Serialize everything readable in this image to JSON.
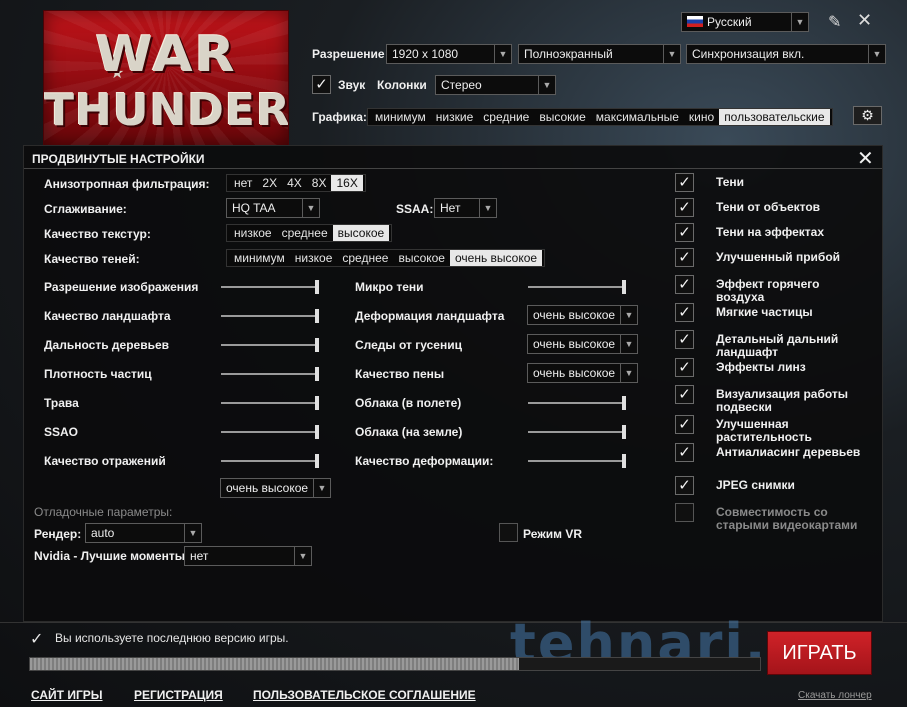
{
  "top": {
    "language": "Русский",
    "resolution_label": "Разрешение",
    "resolution_value": "1920 x 1080",
    "window_mode": "Полноэкранный",
    "vsync": "Синхронизация вкл.",
    "sound_label": "Звук",
    "speakers_label": "Колонки",
    "speakers_value": "Стерео",
    "graphics_label": "Графика:",
    "graphics_presets": [
      "минимум",
      "низкие",
      "средние",
      "высокие",
      "максимальные",
      "кино",
      "пользовательские"
    ],
    "graphics_selected_index": 6,
    "logo_word1": "WAR",
    "logo_word2": "THUNDER"
  },
  "panel": {
    "title": "ПРОДВИНУТЫЕ НАСТРОЙКИ",
    "anisotropy_label": "Анизотропная фильтрация:",
    "anisotropy_options": [
      "нет",
      "2X",
      "4X",
      "8X",
      "16X"
    ],
    "anisotropy_selected": 4,
    "aa_label": "Сглаживание:",
    "aa_value": "HQ TAA",
    "ssaa_label": "SSAA:",
    "ssaa_value": "Нет",
    "texture_label": "Качество текстур:",
    "texture_options": [
      "низкое",
      "среднее",
      "высокое"
    ],
    "texture_selected": 2,
    "shadow_label": "Качество теней:",
    "shadow_options": [
      "минимум",
      "низкое",
      "среднее",
      "высокое",
      "очень высокое"
    ],
    "shadow_selected": 4,
    "left_sliders": [
      {
        "label": "Разрешение изображения",
        "value": 1.0
      },
      {
        "label": "Качество ландшафта",
        "value": 1.0
      },
      {
        "label": "Дальность деревьев",
        "value": 1.0
      },
      {
        "label": "Плотность частиц",
        "value": 1.0
      },
      {
        "label": "Трава",
        "value": 1.0
      },
      {
        "label": "SSAO",
        "value": 1.0
      },
      {
        "label": "Качество отражений",
        "value": 1.0
      }
    ],
    "reflection_dropdown": "очень высокое",
    "middle_rows": [
      {
        "label": "Микро тени",
        "type": "slider",
        "value": 1.0
      },
      {
        "label": "Деформация ландшафта",
        "type": "dropdown",
        "value": "очень высокое"
      },
      {
        "label": "Следы от гусениц",
        "type": "dropdown",
        "value": "очень высокое"
      },
      {
        "label": "Качество пены",
        "type": "dropdown",
        "value": "очень высокое"
      },
      {
        "label": "Облака (в полете)",
        "type": "slider",
        "value": 1.0
      },
      {
        "label": "Облака (на земле)",
        "type": "slider",
        "value": 1.0
      },
      {
        "label": "Качество деформации:",
        "type": "slider",
        "value": 1.0
      }
    ],
    "right_checks": [
      {
        "label": "Тени",
        "checked": true
      },
      {
        "label": "Тени от объектов",
        "checked": true
      },
      {
        "label": "Тени на эффектах",
        "checked": true
      },
      {
        "label": "Улучшенный прибой",
        "checked": true
      },
      {
        "label": "Эффект горячего воздуха",
        "checked": true
      },
      {
        "label": "Мягкие частицы",
        "checked": true
      },
      {
        "label": "Детальный дальний ландшафт",
        "checked": true
      },
      {
        "label": "Эффекты линз",
        "checked": true
      },
      {
        "label": "Визуализация работы подвески",
        "checked": true
      },
      {
        "label": "Улучшенная растительность",
        "checked": true
      },
      {
        "label": "Антиалиасинг деревьев",
        "checked": true
      },
      {
        "label": "JPEG снимки",
        "checked": true
      },
      {
        "label": "Совместимость со старыми видеокартами",
        "checked": false
      }
    ],
    "debug_label": "Отладочные параметры:",
    "render_label": "Рендер:",
    "render_value": "auto",
    "nvidia_label": "Nvidia - Лучшие моменты:",
    "nvidia_value": "нет",
    "vr_label": "Режим VR",
    "vr_checked": false
  },
  "bottom": {
    "status": "Вы используете последнюю версию игры.",
    "progress": 0.67,
    "play": "ИГРАТЬ",
    "watermark": "tehnari.ru",
    "links": [
      "САЙТ ИГРЫ",
      "РЕГИСТРАЦИЯ",
      "ПОЛЬЗОВАТЕЛЬСКОЕ СОГЛАШЕНИЕ"
    ],
    "download_launcher": "Скачать лончер"
  },
  "colors": {
    "accent_red": "#c1141a",
    "selected_bg": "#e8e8e8"
  }
}
